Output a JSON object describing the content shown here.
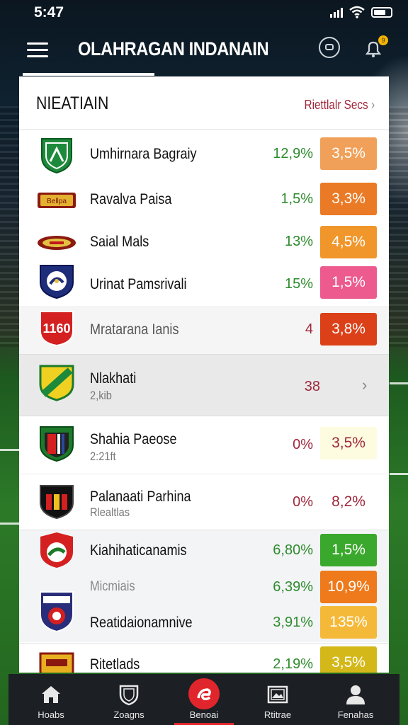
{
  "status": {
    "time": "5:47"
  },
  "appbar": {
    "title": "OLAHRAGAN INDANAIN"
  },
  "card": {
    "title": "NIEATIAIN",
    "see_all": "Riettlalr Secs",
    "chevron": "›"
  },
  "rows": [
    {
      "name": "Umhirnara Bagraiy",
      "sub": "",
      "pct": "12,9%",
      "pct_color": "#2e8b2e",
      "pill": "3,5%",
      "pill_color": "#f0a058",
      "pill_text_color": "#ffffff",
      "highlight": false
    },
    {
      "name": "Ravalva Paisa",
      "sub": "",
      "pct": "1,5%",
      "pct_color": "#2e8b2e",
      "pill": "3,3%",
      "pill_color": "#ea7a25",
      "pill_text_color": "#ffffff",
      "highlight": false
    },
    {
      "name": "Saial Mals",
      "sub": "",
      "pct": "13%",
      "pct_color": "#2e8b2e",
      "pill": "4,5%",
      "pill_color": "#f0962a",
      "pill_text_color": "#ffffff",
      "highlight": false
    },
    {
      "name": "Urinat Pamsrivali",
      "sub": "",
      "pct": "15%",
      "pct_color": "#2e8b2e",
      "pill": "1,5%",
      "pill_color": "#ec5a8e",
      "pill_text_color": "#ffffff",
      "highlight": false
    },
    {
      "name": "Mratarana Ianis",
      "sub": "",
      "pct": "4",
      "pct_color": "#a0283c",
      "pill": "3,8%",
      "pill_color": "#dc4018",
      "pill_text_color": "#ffffff",
      "highlight": false
    },
    {
      "name": "Nlakhati",
      "sub": "2,kib",
      "pct": "38",
      "pct_color": "#a0283c",
      "pill": "",
      "pill_color": "",
      "pill_text_color": "",
      "highlight": true,
      "chevron": "›"
    },
    {
      "name": "Shahia Paeose",
      "sub": "2:21ft",
      "pct": "0%",
      "pct_color": "#a0283c",
      "pill": "3,5%",
      "pill_color": "#fdfbe0",
      "pill_text_color": "#a0283c",
      "highlight": false
    },
    {
      "name": "Palanaati Parhina",
      "sub": "Rlealtlas",
      "pct": "0%",
      "pct_color": "#a0283c",
      "pill": "8,2%",
      "pill_color": "#ffffff",
      "pill_text_color": "#a0283c",
      "highlight": false
    },
    {
      "name": "Kiahihaticanamis",
      "sub": "",
      "pct": "6,80%",
      "pct_color": "#2e8b2e",
      "pill": "1,5%",
      "pill_color": "#3aa82c",
      "pill_text_color": "#ffffff",
      "highlight": false
    },
    {
      "name": "",
      "sub": "Micmiais",
      "pct": "6,39%",
      "pct_color": "#2e8b2e",
      "pill": "10,9%",
      "pill_color": "#ee7a1c",
      "pill_text_color": "#ffffff",
      "highlight": false
    },
    {
      "name": "Reatidaionamnive",
      "sub": "",
      "pct": "3,91%",
      "pct_color": "#2e8b2e",
      "pill": "135%",
      "pill_color": "#f5b93a",
      "pill_text_color": "#ffffff",
      "highlight": false
    },
    {
      "name": "Ritetlads",
      "sub": "",
      "pct": "2,19%",
      "pct_color": "#2e8b2e",
      "pill": "3,5%",
      "pill_color": "#d4b81a",
      "pill_text_color": "#ffffff",
      "highlight": false
    }
  ],
  "crest_texts": {
    "r0": "",
    "r1": "Bellpa",
    "r4": "1160"
  },
  "nav": [
    {
      "label": "Hoabs",
      "icon": "home-icon"
    },
    {
      "label": "Zoagns",
      "icon": "shield-icon"
    },
    {
      "label": "Benoai",
      "icon": "sports-ball-icon"
    },
    {
      "label": "Rtitrae",
      "icon": "image-frame-icon"
    },
    {
      "label": "Fenahas",
      "icon": "person-icon"
    }
  ]
}
